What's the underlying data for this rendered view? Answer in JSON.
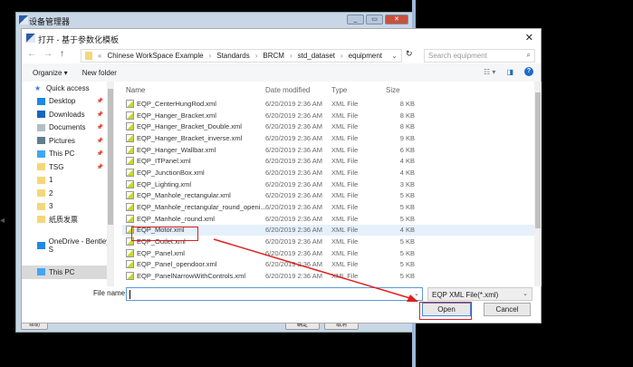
{
  "outer_window": {
    "title": "设备管理器",
    "buttons": [
      "minimize",
      "restore",
      "close"
    ],
    "footer_buttons": [
      "帮助",
      "确定",
      "取消"
    ]
  },
  "dialog": {
    "title": "打开 - 基于参数化模板",
    "breadcrumb": [
      "Chinese WorkSpace Example",
      "Standards",
      "BRCM",
      "std_dataset",
      "equipment"
    ],
    "breadcrumb_prefix": "«",
    "search_placeholder": "Search equipment",
    "toolbar": {
      "organize": "Organize ▾",
      "new_folder": "New folder"
    },
    "sidebar": [
      {
        "label": "Quick access",
        "icon": "star-icon",
        "color": "#3b7ddd",
        "pin": false
      },
      {
        "label": "Desktop",
        "icon": "desktop-icon",
        "color": "#1e88e5",
        "pin": true
      },
      {
        "label": "Downloads",
        "icon": "download-icon",
        "color": "#1565c0",
        "pin": true
      },
      {
        "label": "Documents",
        "icon": "document-icon",
        "color": "#b0bec5",
        "pin": true
      },
      {
        "label": "Pictures",
        "icon": "pictures-icon",
        "color": "#607d8b",
        "pin": true
      },
      {
        "label": "This PC",
        "icon": "computer-icon",
        "color": "#42a5f5",
        "pin": true
      },
      {
        "label": "TSG",
        "icon": "user-folder-icon",
        "color": "#f3d77a",
        "pin": true
      },
      {
        "label": "1",
        "icon": "folder-icon",
        "color": "#f3d77a",
        "pin": false
      },
      {
        "label": "2",
        "icon": "folder-icon",
        "color": "#f3d77a",
        "pin": false
      },
      {
        "label": "3",
        "icon": "folder-icon",
        "color": "#f3d77a",
        "pin": false
      },
      {
        "label": "纸质发票",
        "icon": "folder-icon",
        "color": "#f3d77a",
        "pin": false
      },
      {
        "label": "",
        "icon": "spacer",
        "color": "#fff",
        "pin": false
      },
      {
        "label": "OneDrive - Bentley S",
        "icon": "cloud-icon",
        "color": "#1e88e5",
        "pin": false
      },
      {
        "label": "",
        "icon": "spacer",
        "color": "#fff",
        "pin": false
      },
      {
        "label": "This PC",
        "icon": "computer-icon",
        "color": "#42a5f5",
        "pin": false,
        "selected": true
      }
    ],
    "columns": [
      "Name",
      "Date modified",
      "Type",
      "Size"
    ],
    "files": [
      {
        "name": "EQP_CenterHungRod.xml",
        "date": "6/20/2019 2:36 AM",
        "type": "XML File",
        "size": "8 KB"
      },
      {
        "name": "EQP_Hanger_Bracket.xml",
        "date": "6/20/2019 2:36 AM",
        "type": "XML File",
        "size": "8 KB"
      },
      {
        "name": "EQP_Hanger_Bracket_Double.xml",
        "date": "6/20/2019 2:36 AM",
        "type": "XML File",
        "size": "8 KB"
      },
      {
        "name": "EQP_Hanger_Bracket_inverse.xml",
        "date": "6/20/2019 2:36 AM",
        "type": "XML File",
        "size": "9 KB"
      },
      {
        "name": "EQP_Hanger_Wallbar.xml",
        "date": "6/20/2019 2:36 AM",
        "type": "XML File",
        "size": "6 KB"
      },
      {
        "name": "EQP_ITPanel.xml",
        "date": "6/20/2019 2:36 AM",
        "type": "XML File",
        "size": "4 KB"
      },
      {
        "name": "EQP_JunctionBox.xml",
        "date": "6/20/2019 2:36 AM",
        "type": "XML File",
        "size": "4 KB"
      },
      {
        "name": "EQP_Lighting.xml",
        "date": "6/20/2019 2:36 AM",
        "type": "XML File",
        "size": "3 KB"
      },
      {
        "name": "EQP_Manhole_rectangular.xml",
        "date": "6/20/2019 2:36 AM",
        "type": "XML File",
        "size": "5 KB"
      },
      {
        "name": "EQP_Manhole_rectangular_round_openi...",
        "date": "6/20/2019 2:36 AM",
        "type": "XML File",
        "size": "5 KB"
      },
      {
        "name": "EQP_Manhole_round.xml",
        "date": "6/20/2019 2:36 AM",
        "type": "XML File",
        "size": "5 KB"
      },
      {
        "name": "EQP_Motor.xml",
        "date": "6/20/2019 2:36 AM",
        "type": "XML File",
        "size": "4 KB",
        "hover": true
      },
      {
        "name": "EQP_Outlet.xml",
        "date": "6/20/2019 2:36 AM",
        "type": "XML File",
        "size": "5 KB"
      },
      {
        "name": "EQP_Panel.xml",
        "date": "6/20/2019 2:36 AM",
        "type": "XML File",
        "size": "5 KB"
      },
      {
        "name": "EQP_Panel_opendoor.xml",
        "date": "6/20/2019 2:36 AM",
        "type": "XML File",
        "size": "5 KB"
      },
      {
        "name": "EQP_PanelNarrowWithControls.xml",
        "date": "6/20/2019 2:36 AM",
        "type": "XML File",
        "size": "5 KB"
      }
    ],
    "file_name_label": "File name:",
    "file_name_value": "",
    "file_type": "EQP XML File(*.xml)",
    "open_label": "Open",
    "cancel_label": "Cancel"
  },
  "annotation_color": "#e02020"
}
